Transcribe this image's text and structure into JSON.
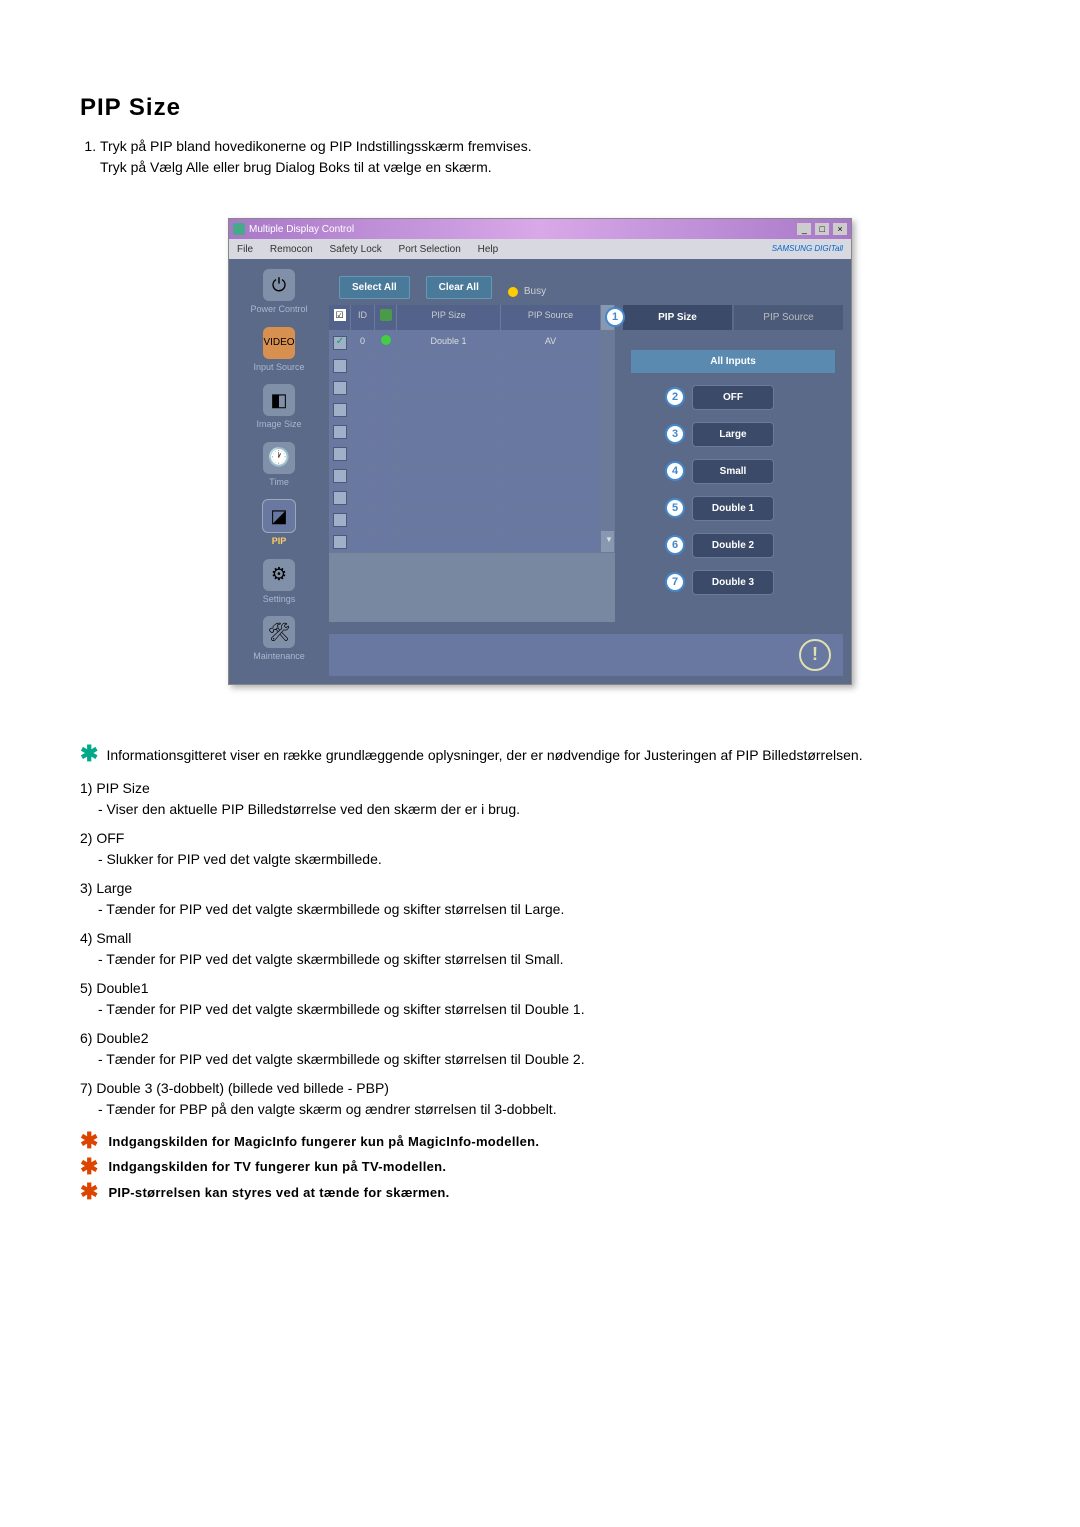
{
  "heading": "PIP Size",
  "intro": {
    "item1_line1": "Tryk på PIP bland hovedikonerne og PIP Indstillingsskærm fremvises.",
    "item1_line2": "Tryk på Vælg Alle eller brug Dialog Boks til at vælge en skærm."
  },
  "app": {
    "title": "Multiple Display Control",
    "menus": [
      "File",
      "Remocon",
      "Safety Lock",
      "Port Selection",
      "Help"
    ],
    "brand": "SAMSUNG DIGITall",
    "sidebar": [
      {
        "label": "Power Control"
      },
      {
        "label": "Input Source"
      },
      {
        "label": "Image Size"
      },
      {
        "label": "Time"
      },
      {
        "label": "PIP"
      },
      {
        "label": "Settings"
      },
      {
        "label": "Maintenance"
      }
    ],
    "toolbar": {
      "select_all": "Select All",
      "clear_all": "Clear All",
      "busy": "Busy"
    },
    "grid": {
      "headers": {
        "id": "ID",
        "pip_size": "PIP Size",
        "pip_source": "PIP Source"
      },
      "rows": [
        {
          "id": "0",
          "pip_size": "Double 1",
          "pip_source": "AV"
        }
      ]
    },
    "right_panel": {
      "tabs": {
        "pip_size": "PIP Size",
        "pip_source": "PIP Source"
      },
      "all_inputs": "All Inputs",
      "options": [
        "OFF",
        "Large",
        "Small",
        "Double 1",
        "Double 2",
        "Double 3"
      ]
    }
  },
  "info_text": "Informationsgitteret viser en række grundlæggende oplysninger, der er nødvendige for Justeringen af PIP Billedstørrelsen.",
  "items": [
    {
      "num": "1)",
      "title": "PIP Size",
      "desc": "- Viser den aktuelle PIP Billedstørrelse ved den skærm der er i brug."
    },
    {
      "num": "2)",
      "title": "OFF",
      "desc": "- Slukker for PIP ved det valgte skærmbillede."
    },
    {
      "num": "3)",
      "title": "Large",
      "desc": "- Tænder for PIP ved det valgte skærmbillede og skifter størrelsen til Large."
    },
    {
      "num": "4)",
      "title": "Small",
      "desc": "- Tænder for PIP ved det valgte skærmbillede og skifter størrelsen til Small."
    },
    {
      "num": "5)",
      "title": "Double1",
      "desc": "- Tænder for PIP ved det valgte skærmbillede og skifter størrelsen til Double 1."
    },
    {
      "num": "6)",
      "title": "Double2",
      "desc": "- Tænder for PIP ved det valgte skærmbillede og skifter størrelsen til Double 2."
    },
    {
      "num": "7)",
      "title": "Double 3 (3-dobbelt) (billede ved billede - PBP)",
      "desc": "- Tænder for PBP på den valgte skærm og ændrer størrelsen til 3-dobbelt."
    }
  ],
  "notes": [
    "Indgangskilden for MagicInfo fungerer kun på MagicInfo-modellen.",
    "Indgangskilden for TV fungerer kun på TV-modellen.",
    "PIP-størrelsen kan styres ved at tænde for skærmen."
  ]
}
